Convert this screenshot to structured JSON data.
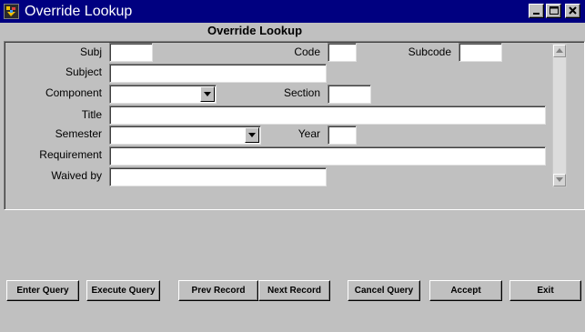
{
  "window": {
    "title": "Override Lookup",
    "icon": "app-icon",
    "controls": [
      "minimize-icon",
      "maximize-icon",
      "close-icon"
    ]
  },
  "form": {
    "heading": "Override Lookup",
    "labels": {
      "subj": "Subj",
      "code": "Code",
      "subcode": "Subcode",
      "subject": "Subject",
      "component": "Component",
      "section": "Section",
      "title": "Title",
      "semester": "Semester",
      "year": "Year",
      "requirement": "Requirement",
      "waived_by": "Waived by"
    },
    "values": {
      "subj": "",
      "code": "",
      "subcode": "",
      "subject": "",
      "component": "",
      "section": "",
      "title": "",
      "semester": "",
      "year": "",
      "requirement": "",
      "waived_by": ""
    }
  },
  "buttons": {
    "enter_query": "Enter Query",
    "execute_query": "Execute Query",
    "prev_record": "Prev Record",
    "next_record": "Next Record",
    "cancel_query": "Cancel Query",
    "accept": "Accept",
    "exit": "Exit"
  },
  "colors": {
    "titlebar": "#000080",
    "window_bg": "#c0c0c0",
    "field_bg": "#ffffff"
  }
}
